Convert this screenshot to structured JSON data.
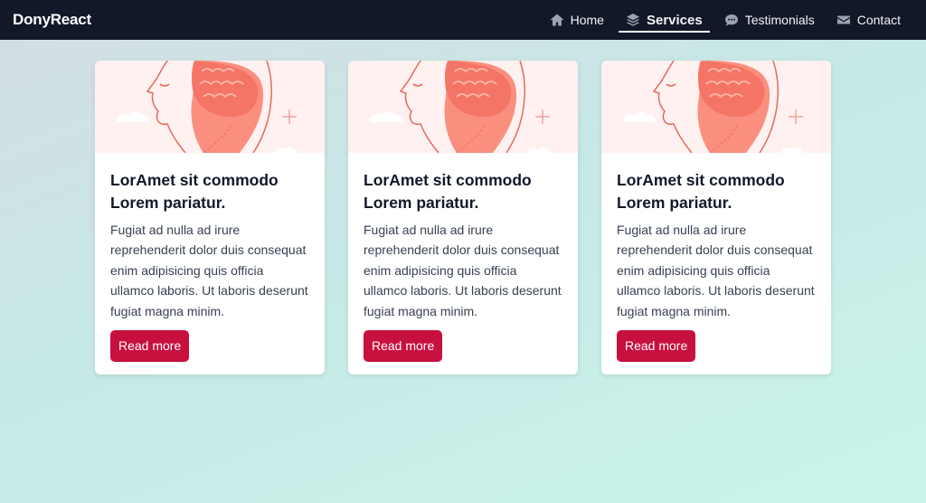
{
  "brand": "DonyReact",
  "nav": {
    "items": [
      {
        "label": "Home",
        "icon": "home-icon",
        "active": false
      },
      {
        "label": "Services",
        "icon": "layers-icon",
        "active": true
      },
      {
        "label": "Testimonials",
        "icon": "chat-icon",
        "active": false
      },
      {
        "label": "Contact",
        "icon": "envelope-icon",
        "active": false
      }
    ]
  },
  "cards": [
    {
      "image": "head-illustration",
      "title": "LorAmet sit commodo Lorem pariatur.",
      "text": "Fugiat ad nulla ad irure reprehenderit dolor duis consequat enim adipisicing quis officia ullamco laboris. Ut laboris deserunt fugiat magna minim.",
      "button": "Read more"
    },
    {
      "image": "head-illustration",
      "title": "LorAmet sit commodo Lorem pariatur.",
      "text": "Fugiat ad nulla ad irure reprehenderit dolor duis consequat enim adipisicing quis officia ullamco laboris. Ut laboris deserunt fugiat magna minim.",
      "button": "Read more"
    },
    {
      "image": "head-illustration",
      "title": "LorAmet sit commodo Lorem pariatur.",
      "text": "Fugiat ad nulla ad irure reprehenderit dolor duis consequat enim adipisicing quis officia ullamco laboris. Ut laboris deserunt fugiat magna minim.",
      "button": "Read more"
    }
  ],
  "colors": {
    "navbar": "#111827",
    "button": "#c8103f",
    "illustration": "#fa8f7f"
  }
}
